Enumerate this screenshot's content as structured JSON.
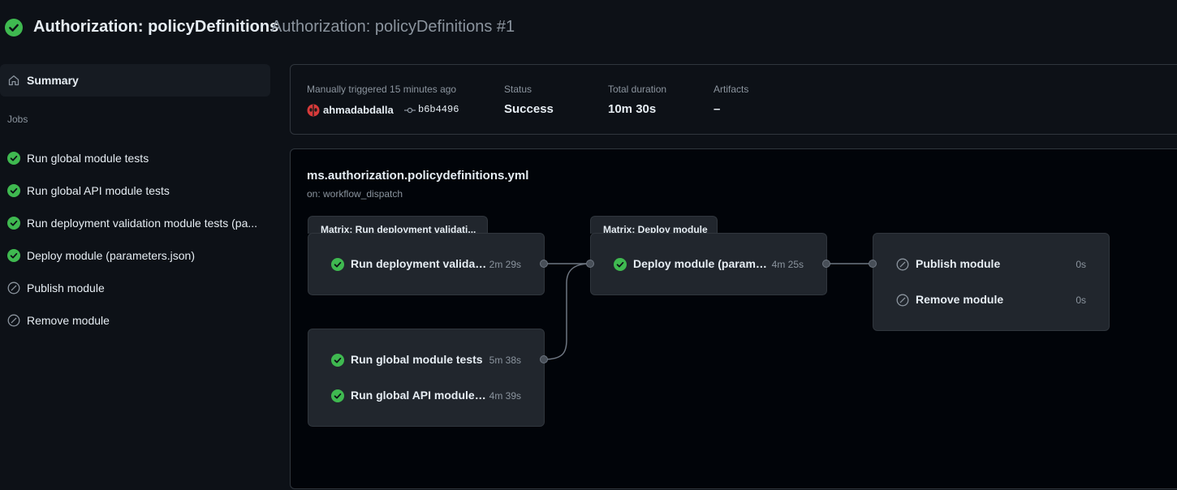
{
  "header": {
    "workflow_name": "Authorization: policyDefinitions",
    "run_title": "Authorization: policyDefinitions #1",
    "status_icon": "success-check-icon"
  },
  "sidebar": {
    "summary_label": "Summary",
    "jobs_heading": "Jobs",
    "jobs": [
      {
        "label": "Run global module tests",
        "status": "success"
      },
      {
        "label": "Run global API module tests",
        "status": "success"
      },
      {
        "label": "Run deployment validation module tests (pa...",
        "status": "success"
      },
      {
        "label": "Deploy module (parameters.json)",
        "status": "success"
      },
      {
        "label": "Publish module",
        "status": "skipped"
      },
      {
        "label": "Remove module",
        "status": "skipped"
      }
    ]
  },
  "run_info": {
    "trigger_label": "Manually triggered 15 minutes ago",
    "actor": "ahmadabdalla",
    "commit": "b6b4496",
    "status_label": "Status",
    "status_value": "Success",
    "duration_label": "Total duration",
    "duration_value": "10m 30s",
    "artifacts_label": "Artifacts",
    "artifacts_value": "–"
  },
  "graph": {
    "file": "ms.authorization.policydefinitions.yml",
    "trigger": "on: workflow_dispatch",
    "matrix_validation": {
      "title": "Matrix: Run deployment validati...",
      "job": {
        "name": "Run deployment validati...",
        "duration": "2m 29s"
      }
    },
    "global_tests": [
      {
        "name": "Run global module tests",
        "duration": "5m 38s"
      },
      {
        "name": "Run global API module t...",
        "duration": "4m 39s"
      }
    ],
    "matrix_deploy": {
      "title": "Matrix: Deploy module",
      "job": {
        "name": "Deploy module (parame...",
        "duration": "4m 25s"
      }
    },
    "final_jobs": [
      {
        "name": "Publish module",
        "duration": "0s"
      },
      {
        "name": "Remove module",
        "duration": "0s"
      }
    ]
  },
  "colors": {
    "success": "#3fb950",
    "skipped": "#8b949e",
    "background": "#0d1117",
    "node": "#21262d",
    "border": "#30363d"
  }
}
